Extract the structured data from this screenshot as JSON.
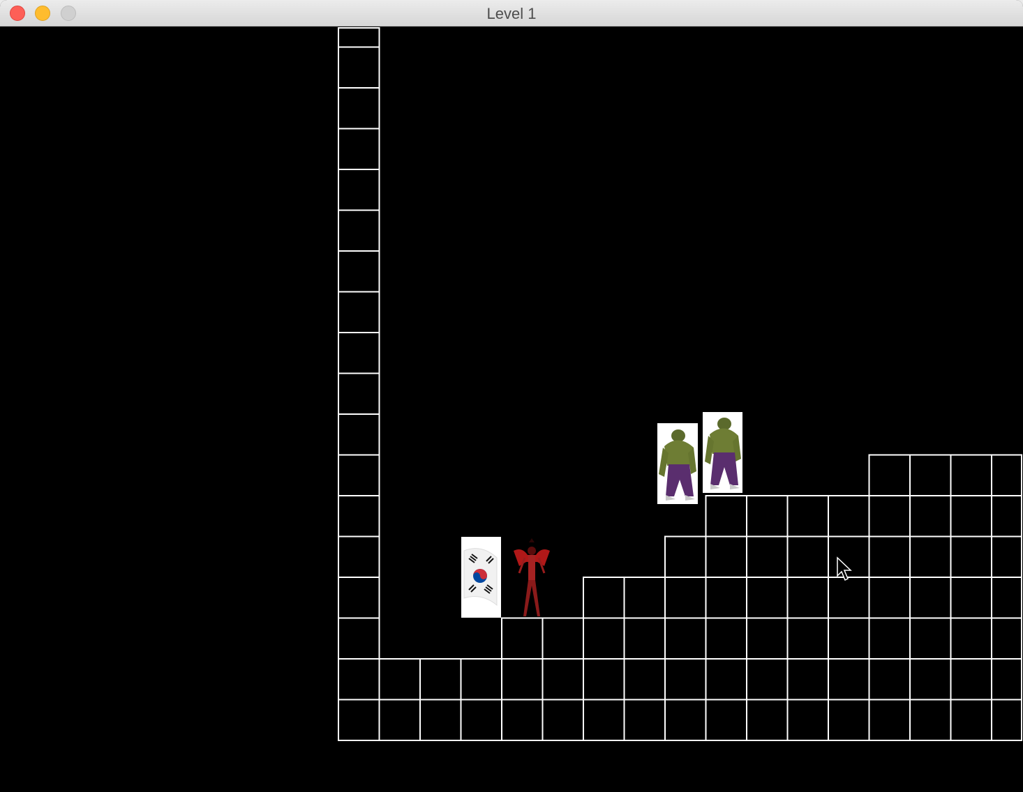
{
  "window": {
    "title": "Level 1",
    "background": "#000000",
    "grid_color": "#ffffff"
  },
  "sprites": {
    "flag": "south-korea-flag",
    "player": "red-caped-hero",
    "enemies": [
      "hulk-enemy",
      "hulk-enemy"
    ]
  }
}
